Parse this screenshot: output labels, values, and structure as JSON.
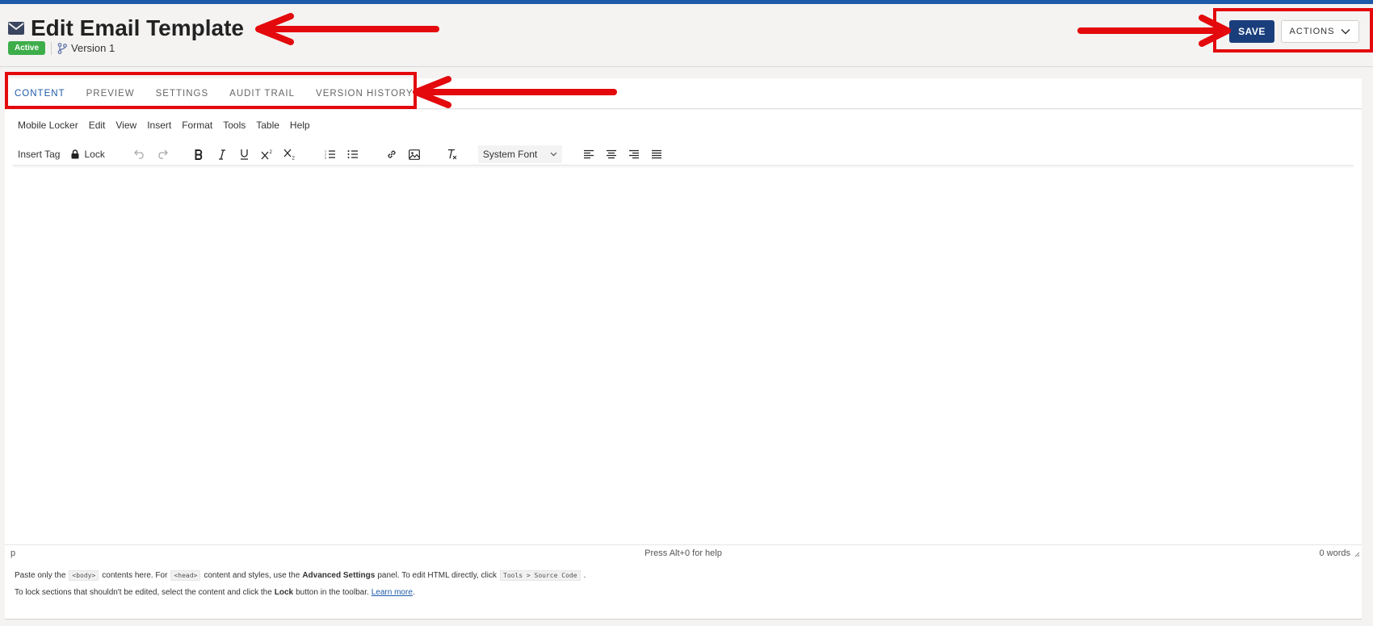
{
  "header": {
    "title": "Edit Email Template",
    "status_badge": "Active",
    "version": "Version 1",
    "save_label": "SAVE",
    "actions_label": "ACTIONS"
  },
  "tabs": [
    {
      "label": "CONTENT",
      "active": true
    },
    {
      "label": "PREVIEW",
      "active": false
    },
    {
      "label": "SETTINGS",
      "active": false
    },
    {
      "label": "AUDIT TRAIL",
      "active": false
    },
    {
      "label": "VERSION HISTORY",
      "active": false
    }
  ],
  "editor": {
    "menu": [
      "Mobile Locker",
      "Edit",
      "View",
      "Insert",
      "Format",
      "Tools",
      "Table",
      "Help"
    ],
    "toolbar": {
      "insert_tag": "Insert Tag",
      "lock": "Lock",
      "font": "System Font",
      "icons": [
        "lock-icon",
        "undo-icon",
        "redo-icon",
        "bold-icon",
        "italic-icon",
        "underline-icon",
        "superscript-icon",
        "subscript-icon",
        "numbered-list-icon",
        "bullet-list-icon",
        "link-icon",
        "image-icon",
        "clear-formatting-icon",
        "align-left-icon",
        "align-center-icon",
        "align-right-icon",
        "justify-icon"
      ]
    },
    "status": {
      "path": "p",
      "help": "Press Alt+0 for help",
      "word_count": "0 words"
    }
  },
  "notes": {
    "line1": {
      "t1": "Paste only the",
      "c1": "<body>",
      "t2": "contents here. For",
      "c2": "<head>",
      "t3": "content and styles, use the",
      "b1": "Advanced Settings",
      "t4": "panel. To edit HTML directly, click",
      "c3": "Tools > Source Code",
      "t5": "."
    },
    "line2": {
      "t1": "To lock sections that shouldn't be edited, select the content and click the",
      "b1": "Lock",
      "t2": "button in the toolbar.",
      "link": "Learn more",
      "t3": "."
    }
  },
  "colors": {
    "top_bar": "#1d5aa8",
    "save_button": "#1a3e7c",
    "active_badge": "#3dae4a",
    "active_tab": "#1d5aa8",
    "annotation": "#e3090c"
  }
}
